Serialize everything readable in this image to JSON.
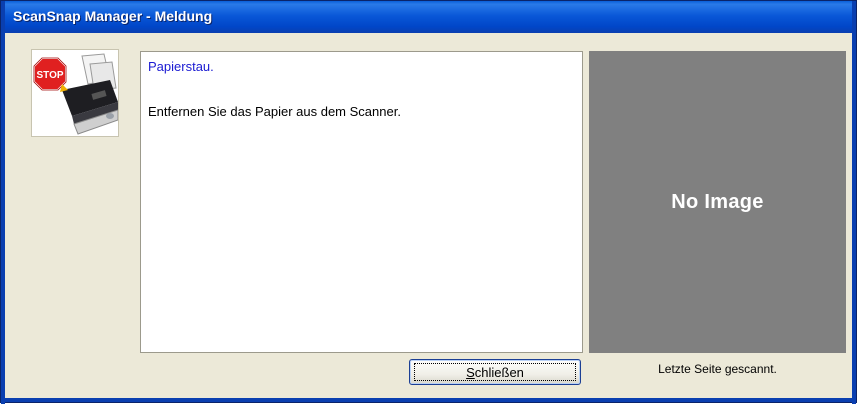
{
  "window": {
    "title": "ScanSnap Manager - Meldung"
  },
  "message": {
    "line1": "Papierstau.",
    "line2": "Entfernen Sie das Papier aus dem Scanner."
  },
  "icon": {
    "name": "stop-scanner-icon",
    "stop_label": "STOP"
  },
  "preview": {
    "placeholder": "No Image"
  },
  "status": {
    "text": "Letzte Seite gescannt."
  },
  "close_button": {
    "mnemonic": "S",
    "label_rest": "chließen"
  },
  "colors": {
    "titlebar": "#0a58d8",
    "message_blue": "#1a1ad2",
    "preview_bg": "#808080",
    "window_bg": "#ece9d8"
  }
}
